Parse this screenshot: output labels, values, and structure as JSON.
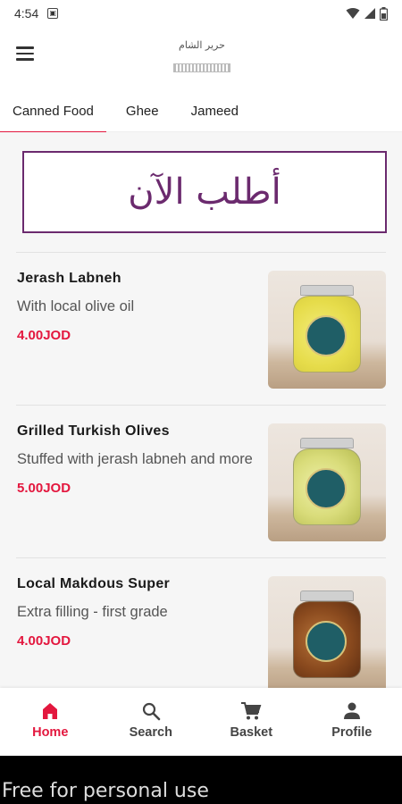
{
  "status_bar": {
    "time": "4:54",
    "notification_icon": "app-notification-icon"
  },
  "app_bar": {
    "menu_icon": "hamburger-menu-icon",
    "logo_text": "حرير الشام"
  },
  "tabs": [
    {
      "label": "Canned Food",
      "active": true
    },
    {
      "label": "Ghee",
      "active": false
    },
    {
      "label": "Jameed",
      "active": false
    }
  ],
  "banner": {
    "text": "أطلب الآن",
    "color": "#6b2a6e"
  },
  "products": [
    {
      "name": "Jerash Labneh",
      "description": "With local olive oil",
      "price": "4.00JOD"
    },
    {
      "name": "Grilled Turkish Olives",
      "description": "Stuffed with jerash labneh and more",
      "price": "5.00JOD"
    },
    {
      "name": "Local Makdous Super",
      "description": "Extra filling - first grade",
      "price": "4.00JOD"
    }
  ],
  "bottom_nav": [
    {
      "label": "Home",
      "icon": "home-icon",
      "active": true
    },
    {
      "label": "Search",
      "icon": "search-icon",
      "active": false
    },
    {
      "label": "Basket",
      "icon": "cart-icon",
      "active": false
    },
    {
      "label": "Profile",
      "icon": "person-icon",
      "active": false
    }
  ],
  "watermark": {
    "text": "Free for personal use"
  },
  "colors": {
    "accent": "#e3173e",
    "brand_purple": "#6b2a6e"
  }
}
